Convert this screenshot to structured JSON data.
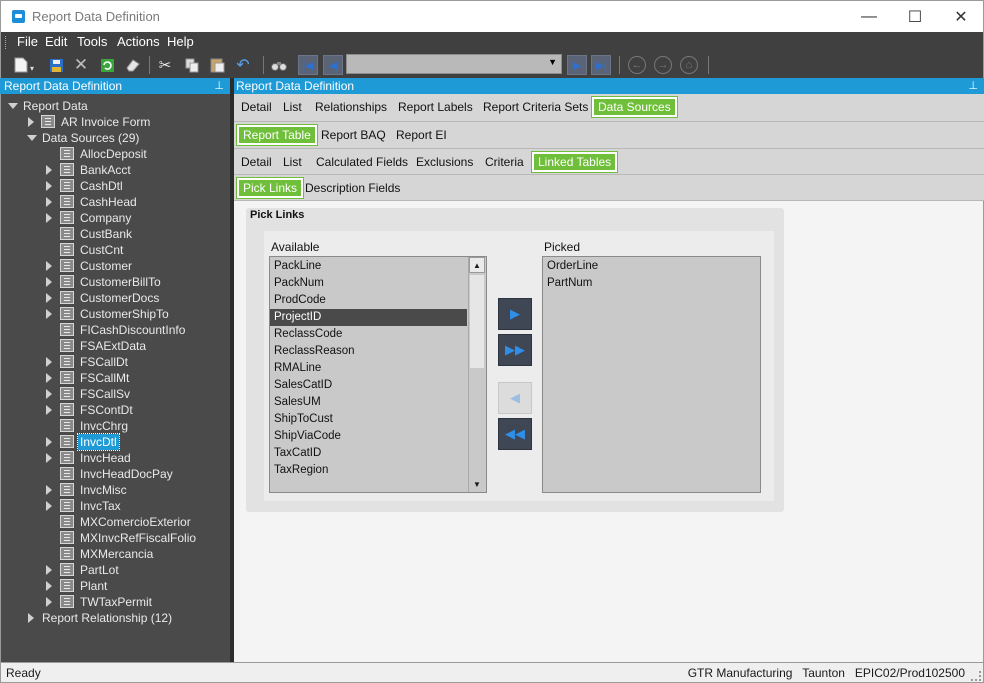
{
  "window": {
    "title": "Report Data Definition",
    "minimize": "—",
    "maximize": "☐",
    "close": "✕"
  },
  "menu": [
    "File",
    "Edit",
    "Tools",
    "Actions",
    "Help"
  ],
  "left_panel": {
    "title": "Report Data Definition",
    "pin": "⊥",
    "tree": {
      "root": "Report Data",
      "ar_invoice_form": "AR Invoice Form",
      "data_sources": "Data Sources (29)",
      "items": [
        {
          "label": "AllocDeposit",
          "expandable": false
        },
        {
          "label": "BankAcct",
          "expandable": true
        },
        {
          "label": "CashDtl",
          "expandable": true
        },
        {
          "label": "CashHead",
          "expandable": true
        },
        {
          "label": "Company",
          "expandable": true
        },
        {
          "label": "CustBank",
          "expandable": false
        },
        {
          "label": "CustCnt",
          "expandable": false
        },
        {
          "label": "Customer",
          "expandable": true
        },
        {
          "label": "CustomerBillTo",
          "expandable": true
        },
        {
          "label": "CustomerDocs",
          "expandable": true
        },
        {
          "label": "CustomerShipTo",
          "expandable": true
        },
        {
          "label": "FICashDiscountInfo",
          "expandable": false
        },
        {
          "label": "FSAExtData",
          "expandable": false
        },
        {
          "label": "FSCallDt",
          "expandable": true
        },
        {
          "label": "FSCallMt",
          "expandable": true
        },
        {
          "label": "FSCallSv",
          "expandable": true
        },
        {
          "label": "FSContDt",
          "expandable": true
        },
        {
          "label": "InvcChrg",
          "expandable": false
        },
        {
          "label": "InvcDtl",
          "expandable": true,
          "selected": true
        },
        {
          "label": "InvcHead",
          "expandable": true
        },
        {
          "label": "InvcHeadDocPay",
          "expandable": false
        },
        {
          "label": "InvcMisc",
          "expandable": true
        },
        {
          "label": "InvcTax",
          "expandable": true
        },
        {
          "label": "MXComercioExterior",
          "expandable": false
        },
        {
          "label": "MXInvcRefFiscalFolio",
          "expandable": false
        },
        {
          "label": "MXMercancia",
          "expandable": false
        },
        {
          "label": "PartLot",
          "expandable": true
        },
        {
          "label": "Plant",
          "expandable": true
        },
        {
          "label": "TWTaxPermit",
          "expandable": true
        }
      ],
      "report_relationship": "Report Relationship (12)"
    }
  },
  "right_panel": {
    "title": "Report Data Definition",
    "pin": "⊥",
    "tabs_level1": [
      "Detail",
      "List",
      "Relationships",
      "Report Labels",
      "Report Criteria Sets",
      "Data Sources"
    ],
    "tabs_level2": [
      "Report Table",
      "Report BAQ",
      "Report EI"
    ],
    "tabs_level3": [
      "Detail",
      "List",
      "Calculated Fields",
      "Exclusions",
      "Criteria",
      "Linked Tables"
    ],
    "tabs_level4": [
      "Pick Links",
      "Description Fields"
    ],
    "pick_links": {
      "group_title": "Pick Links",
      "available_label": "Available",
      "picked_label": "Picked",
      "available": [
        "PackLine",
        "PackNum",
        "ProdCode",
        "ProjectID",
        "ReclassCode",
        "ReclassReason",
        "RMALine",
        "SalesCatID",
        "SalesUM",
        "ShipToCust",
        "ShipViaCode",
        "TaxCatID",
        "TaxRegion"
      ],
      "available_selected": "ProjectID",
      "picked": [
        "OrderLine",
        "PartNum"
      ]
    }
  },
  "status": {
    "left": "Ready",
    "right": "GTR Manufacturing   Taunton   EPIC02/Prod102500"
  },
  "colors": {
    "accent_blue": "#1e9ad6",
    "active_tab_green": "#6fbf3a"
  }
}
